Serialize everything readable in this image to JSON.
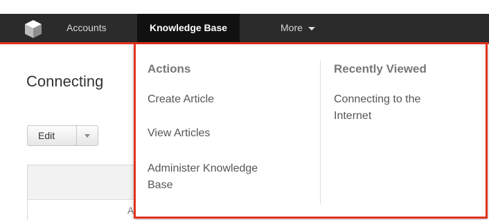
{
  "nav": {
    "accounts": "Accounts",
    "knowledge_base": "Knowledge Base",
    "more": "More"
  },
  "page": {
    "title": "Connecting",
    "edit_label": "Edit",
    "panel_letter": "A"
  },
  "menu": {
    "actions_heading": "Actions",
    "actions": [
      "Create Article",
      "View Articles",
      "Administer Knowledge",
      "Base"
    ],
    "recent_heading": "Recently Viewed",
    "recent": [
      "Connecting to the",
      "Internet"
    ]
  },
  "colors": {
    "accent": "#e0321c",
    "navbar": "#2b2b2b",
    "active_tab": "#111111"
  }
}
